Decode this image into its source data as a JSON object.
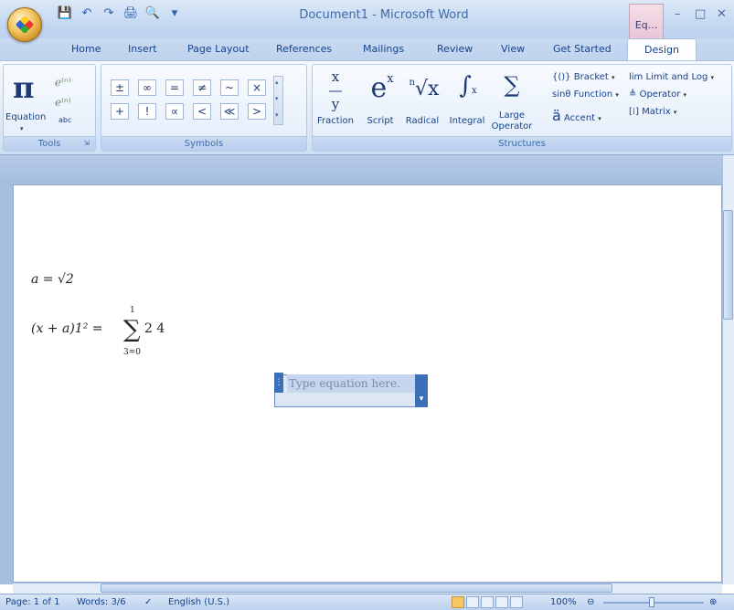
{
  "window": {
    "title": "Document1 - Microsoft Word",
    "context_tab_label": "Eq...",
    "controls": [
      "–",
      "□",
      "✕"
    ]
  },
  "quick_access": {
    "icons": [
      "save-icon",
      "undo-icon",
      "redo-icon",
      "print-icon",
      "print-preview-icon",
      "customize-icon"
    ],
    "glyphs": [
      "💾",
      "↶",
      "↷",
      "🖨",
      "🔍",
      "▾"
    ]
  },
  "tabs": [
    "Home",
    "Insert",
    "Page Layout",
    "References",
    "Mailings",
    "Review",
    "View",
    "Get Started",
    "Design"
  ],
  "active_tab": "Design",
  "ribbon": {
    "tools": {
      "group_label": "Tools",
      "equation_label": "Equation",
      "abc_label": "abc",
      "pi": "π"
    },
    "symbols": {
      "group_label": "Symbols",
      "row1": [
        "±",
        "∞",
        "=",
        "≠",
        "~",
        "×"
      ],
      "row2": [
        "+",
        "!",
        "∝",
        "<",
        "≪",
        ">"
      ]
    },
    "structures": {
      "group_label": "Structures",
      "fraction": {
        "label": "Fraction",
        "glyph": "x/y"
      },
      "script": {
        "label": "Script",
        "glyph": "eˣ"
      },
      "radical": {
        "label": "Radical",
        "glyph": "ⁿ√x"
      },
      "integral": {
        "label": "Integral",
        "glyph": "∫"
      },
      "large_operator": {
        "label": "Large Operator",
        "glyph": "∑"
      },
      "bracket": "Bracket",
      "function": "Function",
      "accent": "Accent",
      "limit_and_log": "Limit and Log",
      "operator": "Operator",
      "matrix": "Matrix"
    }
  },
  "document": {
    "eq1": "a = √2",
    "eq2_left": "(x + a)1² =",
    "eq2_sum_top": "1",
    "eq2_sum_bottom": "3=0",
    "eq2_right": "2 4",
    "placeholder": "Type equation here."
  },
  "status": {
    "page": "Page: 1 of 1",
    "words": "Words: 3/6",
    "language": "English (U.S.)",
    "zoom": "100%"
  }
}
